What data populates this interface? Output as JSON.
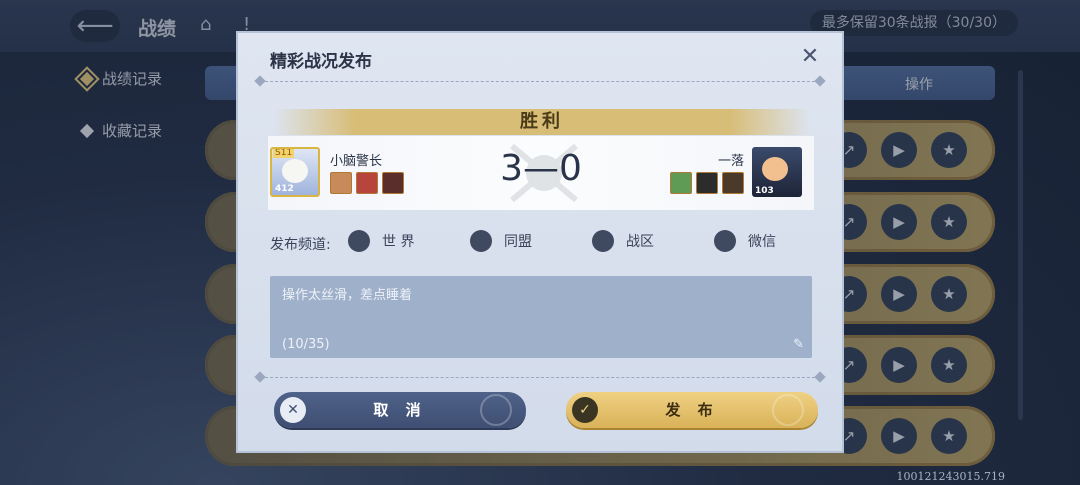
{
  "header": {
    "title": "战绩",
    "report_count": "最多保留30条战报（30/30）",
    "icons": [
      "back-arrow-icon",
      "home-icon",
      "info-icon"
    ]
  },
  "sidebar": {
    "items": [
      {
        "label": "战绩记录",
        "active": true
      },
      {
        "label": "收藏记录",
        "active": false
      }
    ]
  },
  "table": {
    "operation_header": "操作",
    "row_action_icons": [
      "share-icon",
      "play-icon",
      "star-icon"
    ]
  },
  "dialog": {
    "title": "精彩战况发布",
    "result": "胜利",
    "player_left": {
      "name": "小脑警长",
      "level": "412",
      "badge": "S11"
    },
    "player_right": {
      "name": "一落",
      "level": "103"
    },
    "score": "3—0",
    "channel_label": "发布频道:",
    "channels": [
      "世 界",
      "同盟",
      "战区",
      "微信"
    ],
    "message": "操作太丝滑，差点睡着",
    "char_count": "(10/35)",
    "cancel_label": "取 消",
    "publish_label": "发 布"
  },
  "footer": {
    "version": "100121243015.719"
  },
  "colors": {
    "accent_gold": "#d9b258",
    "button_blue": "#4f6289",
    "dialog_bg": "#dfe6f1"
  }
}
